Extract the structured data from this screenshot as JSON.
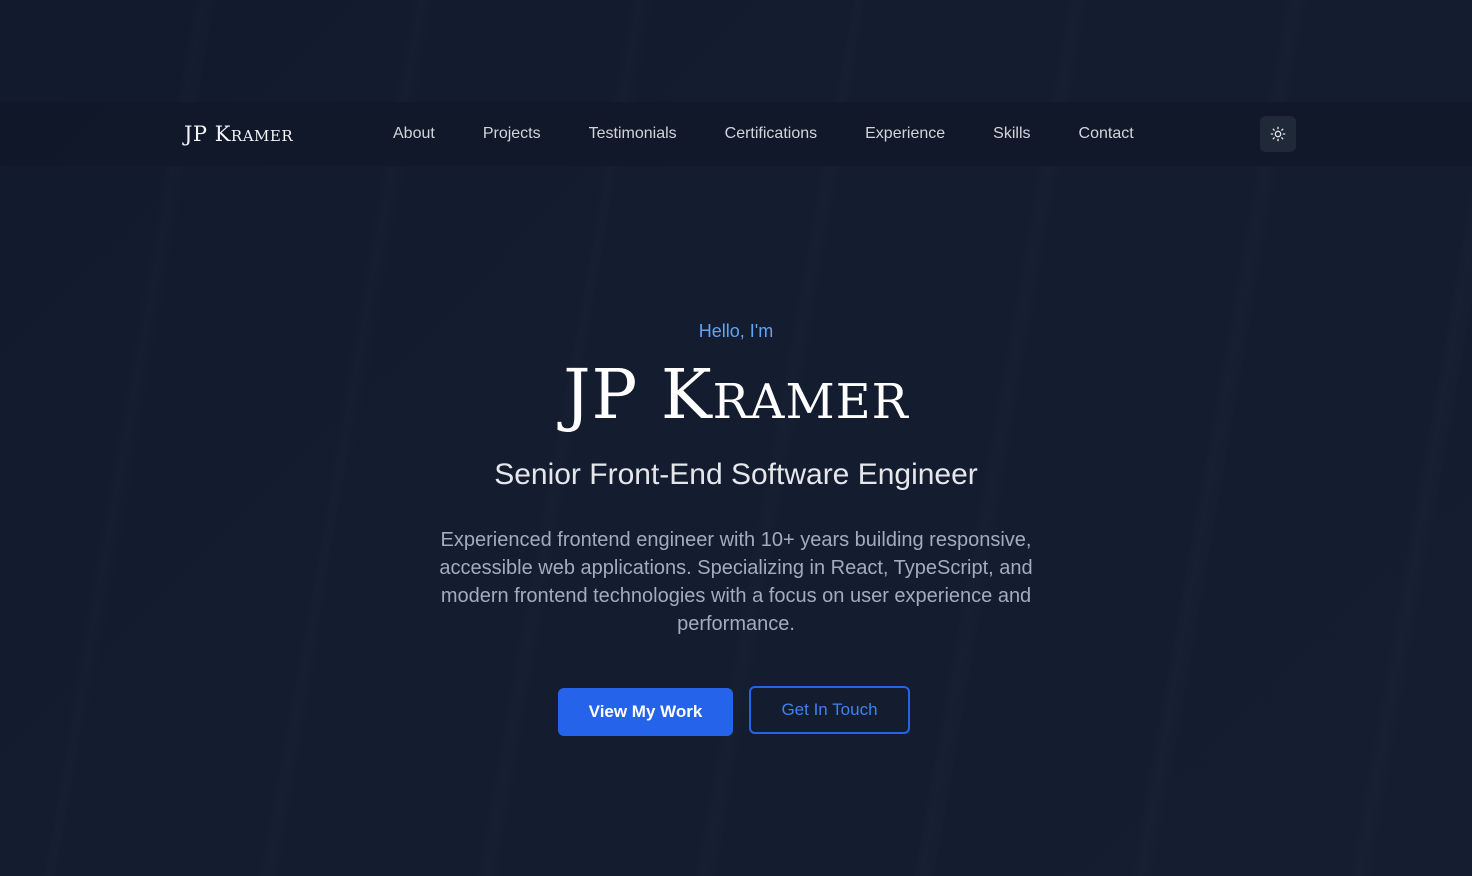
{
  "nav": {
    "brand": "JP Kramer",
    "links": [
      "About",
      "Projects",
      "Testimonials",
      "Certifications",
      "Experience",
      "Skills",
      "Contact"
    ],
    "theme_toggle_icon": "sun-icon"
  },
  "hero": {
    "greeting": "Hello, I'm",
    "name": "JP Kramer",
    "title": "Senior Front-End Software Engineer",
    "description": "Experienced frontend engineer with 10+ years building responsive, accessible web applications. Specializing in React, TypeScript, and modern frontend technologies with a focus on user experience and performance.",
    "primary_button": "View My Work",
    "secondary_button": "Get In Touch"
  },
  "colors": {
    "background": "#131b2f",
    "accent": "#2563eb",
    "greeting": "#60a5fa"
  }
}
